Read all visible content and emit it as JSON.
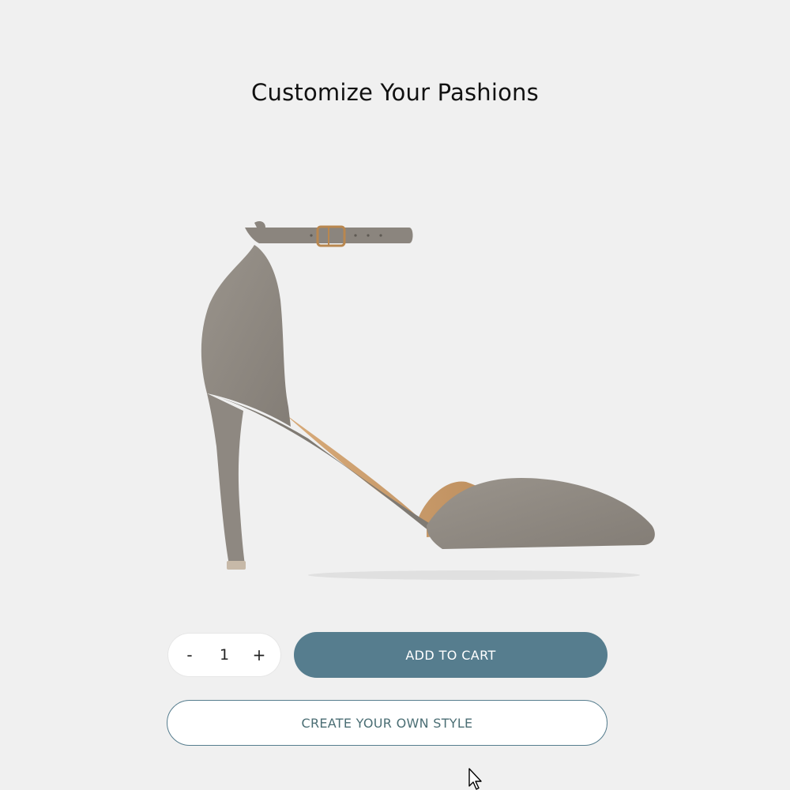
{
  "page": {
    "title": "Customize Your Pashions"
  },
  "product": {
    "image_icon": "high-heel-shoe-image",
    "colors": {
      "suede": "#8c867e",
      "lining": "#c79a6d",
      "buckle": "#b9874f"
    }
  },
  "quantity": {
    "decrement_label": "-",
    "value": "1",
    "increment_label": "+"
  },
  "actions": {
    "add_to_cart_label": "ADD TO CART",
    "create_style_label": "CREATE YOUR OWN STYLE"
  },
  "theme": {
    "accent": "#567d8e",
    "background": "#f0f0f0"
  },
  "cursor_icon": "mouse-pointer-icon"
}
